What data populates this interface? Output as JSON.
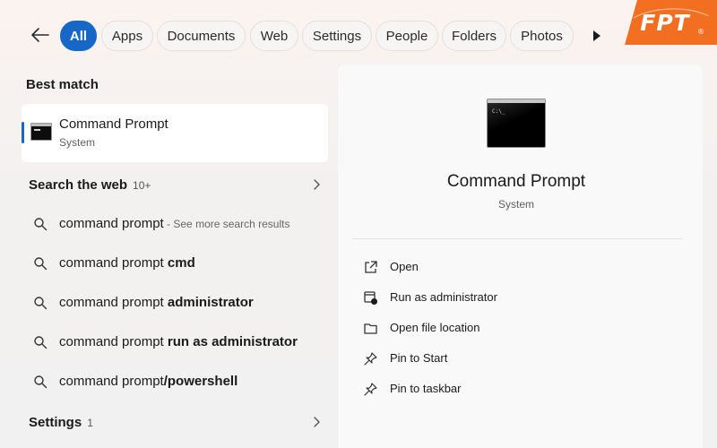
{
  "filters": {
    "items": [
      {
        "label": "All",
        "active": true
      },
      {
        "label": "Apps",
        "active": false
      },
      {
        "label": "Documents",
        "active": false
      },
      {
        "label": "Web",
        "active": false
      },
      {
        "label": "Settings",
        "active": false
      },
      {
        "label": "People",
        "active": false
      },
      {
        "label": "Folders",
        "active": false
      },
      {
        "label": "Photos",
        "active": false
      }
    ],
    "accent_color": "#1767c8"
  },
  "logo": {
    "text": "FPT",
    "color": "#f26f21"
  },
  "best_match": {
    "heading": "Best match",
    "app_name": "Command Prompt",
    "app_type": "System"
  },
  "search_web": {
    "heading": "Search the web",
    "count": "10+",
    "suggestions": [
      {
        "prefix": "command prompt",
        "bold": "",
        "extra": " - See more search results"
      },
      {
        "prefix": "command prompt ",
        "bold": "cmd",
        "extra": ""
      },
      {
        "prefix": "command prompt ",
        "bold": "administrator",
        "extra": ""
      },
      {
        "prefix": "command prompt ",
        "bold": "run as administrator",
        "extra": ""
      },
      {
        "prefix": "command prompt",
        "bold": "/powershell",
        "extra": ""
      }
    ]
  },
  "settings_section": {
    "heading": "Settings",
    "count": "1"
  },
  "detail": {
    "title": "Command Prompt",
    "subtitle": "System",
    "actions": [
      {
        "label": "Open",
        "icon": "open-external-icon"
      },
      {
        "label": "Run as administrator",
        "icon": "shield-admin-icon"
      },
      {
        "label": "Open file location",
        "icon": "folder-icon"
      },
      {
        "label": "Pin to Start",
        "icon": "pin-icon"
      },
      {
        "label": "Pin to taskbar",
        "icon": "pin-icon"
      }
    ]
  }
}
